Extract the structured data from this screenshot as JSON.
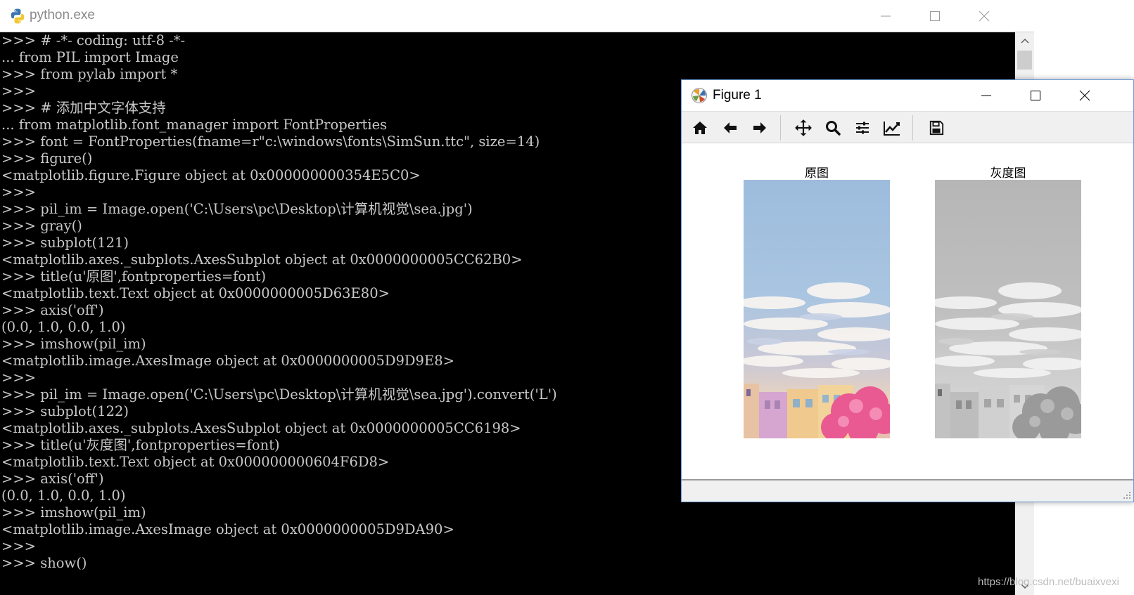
{
  "console": {
    "title": "python.exe",
    "app_icon": "python-icon",
    "lines": [
      ">>> # -*- coding: utf-8 -*-",
      "... from PIL import Image",
      ">>> from pylab import *",
      ">>>",
      ">>> # 添加中文字体支持",
      "... from matplotlib.font_manager import FontProperties",
      ">>> font = FontProperties(fname=r\"c:\\windows\\fonts\\SimSun.ttc\", size=14)",
      ">>> figure()",
      "<matplotlib.figure.Figure object at 0x000000000354E5C0>",
      ">>>",
      ">>> pil_im = Image.open('C:\\Users\\pc\\Desktop\\计算机视觉\\sea.jpg')",
      ">>> gray()",
      ">>> subplot(121)",
      "<matplotlib.axes._subplots.AxesSubplot object at 0x0000000005CC62B0>",
      ">>> title(u'原图',fontproperties=font)",
      "<matplotlib.text.Text object at 0x0000000005D63E80>",
      ">>> axis('off')",
      "(0.0, 1.0, 0.0, 1.0)",
      ">>> imshow(pil_im)",
      "<matplotlib.image.AxesImage object at 0x0000000005D9D9E8>",
      ">>>",
      ">>> pil_im = Image.open('C:\\Users\\pc\\Desktop\\计算机视觉\\sea.jpg').convert('L')",
      ">>> subplot(122)",
      "<matplotlib.axes._subplots.AxesSubplot object at 0x0000000005CC6198>",
      ">>> title(u'灰度图',fontproperties=font)",
      "<matplotlib.text.Text object at 0x000000000604F6D8>",
      ">>> axis('off')",
      "(0.0, 1.0, 0.0, 1.0)",
      ">>> imshow(pil_im)",
      "<matplotlib.image.AxesImage object at 0x0000000005D9DA90>",
      ">>>",
      ">>> show()"
    ],
    "window_controls": [
      "minimize-icon",
      "maximize-icon",
      "close-icon"
    ],
    "text_color": "#c8c8c8",
    "background_color": "#000000"
  },
  "figure": {
    "title": "Figure 1",
    "app_icon": "matplotlib-icon",
    "toolbar": [
      {
        "name": "home-icon"
      },
      {
        "name": "back-arrow-icon"
      },
      {
        "name": "forward-arrow-icon"
      },
      {
        "name": "pan-icon"
      },
      {
        "name": "zoom-icon"
      },
      {
        "name": "configure-subplots-icon"
      },
      {
        "name": "edit-axis-icon"
      },
      {
        "name": "save-icon"
      }
    ],
    "subplots": [
      {
        "title": "原图",
        "mode": "color"
      },
      {
        "title": "灰度图",
        "mode": "grayscale"
      }
    ],
    "accent_border": "#6b9bd6"
  },
  "watermark": "https://blog.csdn.net/buaixvexi"
}
